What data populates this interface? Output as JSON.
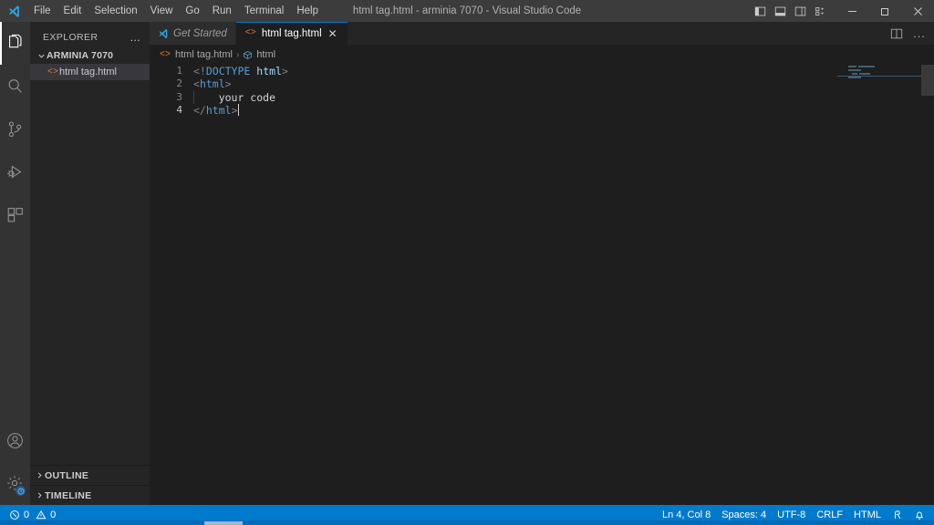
{
  "window": {
    "title": "html tag.html - arminia 7070 - Visual Studio Code",
    "logo_icon": "vscode-logo-icon",
    "controls": {
      "minimize": "minimize-icon",
      "maximize": "maximize-icon",
      "close": "close-icon"
    },
    "layout_toggles": [
      {
        "name": "toggle-primary-sidebar",
        "icon": "panel-left-icon"
      },
      {
        "name": "toggle-panel",
        "icon": "panel-bottom-icon"
      },
      {
        "name": "toggle-secondary-sidebar",
        "icon": "panel-right-icon"
      },
      {
        "name": "customize-layout",
        "icon": "layout-grid-icon"
      }
    ]
  },
  "menu": [
    {
      "label": "File"
    },
    {
      "label": "Edit"
    },
    {
      "label": "Selection"
    },
    {
      "label": "View"
    },
    {
      "label": "Go"
    },
    {
      "label": "Run"
    },
    {
      "label": "Terminal"
    },
    {
      "label": "Help"
    }
  ],
  "activitybar": {
    "items": [
      {
        "name": "explorer",
        "icon": "files-icon",
        "active": true
      },
      {
        "name": "search",
        "icon": "search-icon",
        "active": false
      },
      {
        "name": "source-control",
        "icon": "source-control-icon",
        "active": false
      },
      {
        "name": "run-and-debug",
        "icon": "run-debug-icon",
        "active": false
      },
      {
        "name": "extensions",
        "icon": "extensions-icon",
        "active": false
      }
    ],
    "bottom": [
      {
        "name": "accounts",
        "icon": "account-icon"
      },
      {
        "name": "manage-settings",
        "icon": "gear-icon",
        "badge": true
      }
    ]
  },
  "sidebar": {
    "title": "EXPLORER",
    "more_actions": "...",
    "folder": {
      "label": "ARMINIA 7070",
      "expanded": true,
      "chevron_icon": "chevron-down-icon"
    },
    "files": [
      {
        "label": "html tag.html",
        "icon": "html-file-icon",
        "selected": true
      }
    ],
    "sections": [
      {
        "label": "OUTLINE",
        "chevron_icon": "chevron-right-icon"
      },
      {
        "label": "TIMELINE",
        "chevron_icon": "chevron-right-icon"
      }
    ]
  },
  "tabs": [
    {
      "label": "Get Started",
      "icon": "vscode-logo-icon",
      "active": false,
      "italic": true,
      "closable": false
    },
    {
      "label": "html tag.html",
      "icon": "html-file-icon",
      "active": true,
      "italic": false,
      "closable": true,
      "close_icon": "close-icon"
    }
  ],
  "editor_actions": [
    {
      "name": "split-editor-right",
      "icon": "split-editor-icon"
    },
    {
      "name": "more-actions",
      "icon": "ellipsis-icon",
      "label": "..."
    }
  ],
  "breadcrumb": {
    "file": "html tag.html",
    "file_icon": "html-file-icon",
    "separator": "›",
    "symbol": "html",
    "symbol_icon": "symbol-field-icon"
  },
  "editor": {
    "lines": [
      {
        "number": "1",
        "current": false,
        "tokens": [
          {
            "text": "<!",
            "type": "punct"
          },
          {
            "text": "DOCTYPE",
            "type": "doctype"
          },
          {
            "text": " ",
            "type": "text"
          },
          {
            "text": "html",
            "type": "attr"
          },
          {
            "text": ">",
            "type": "punct"
          }
        ]
      },
      {
        "number": "2",
        "current": false,
        "tokens": [
          {
            "text": "<",
            "type": "punct"
          },
          {
            "text": "html",
            "type": "tag"
          },
          {
            "text": ">",
            "type": "punct"
          }
        ]
      },
      {
        "number": "3",
        "current": false,
        "indent_guide": true,
        "tokens": [
          {
            "text": "    your code",
            "type": "text"
          }
        ]
      },
      {
        "number": "4",
        "current": true,
        "caret": true,
        "tokens": [
          {
            "text": "</",
            "type": "punct"
          },
          {
            "text": "html",
            "type": "tag"
          },
          {
            "text": ">",
            "type": "punct"
          }
        ]
      }
    ],
    "plain_text": "<!DOCTYPE html>\n<html>\n    your code\n</html>"
  },
  "minimap": {
    "rows": [
      {
        "blocks": [
          9,
          18
        ]
      },
      {
        "blocks": [
          14
        ]
      },
      {
        "blocks": [
          6,
          12
        ]
      },
      {
        "blocks": [
          14
        ]
      }
    ]
  },
  "statusbar": {
    "left": [
      {
        "name": "problems",
        "error_icon": "error-circle-icon",
        "errors": "0",
        "warning_icon": "warning-triangle-icon",
        "warnings": "0"
      }
    ],
    "right": [
      {
        "name": "editor-position",
        "label": "Ln 4, Col 8"
      },
      {
        "name": "editor-indentation",
        "label": "Spaces: 4"
      },
      {
        "name": "editor-encoding",
        "label": "UTF-8"
      },
      {
        "name": "editor-eol",
        "label": "CRLF"
      },
      {
        "name": "editor-language",
        "label": "HTML"
      },
      {
        "name": "feedback",
        "icon": "tweet-feedback-icon"
      },
      {
        "name": "notifications",
        "icon": "bell-icon"
      }
    ]
  },
  "colors": {
    "titlebar_bg": "#3c3c3c",
    "activitybar_bg": "#333333",
    "sidebar_bg": "#252526",
    "editor_bg": "#1e1e1e",
    "statusbar_bg": "#007acc",
    "accent": "#0078d4",
    "tag_color": "#569cd6",
    "attr_color": "#9cdcfe",
    "text_color": "#d4d4d4",
    "html_icon_color": "#e37933",
    "selection_bg": "#37373d"
  }
}
